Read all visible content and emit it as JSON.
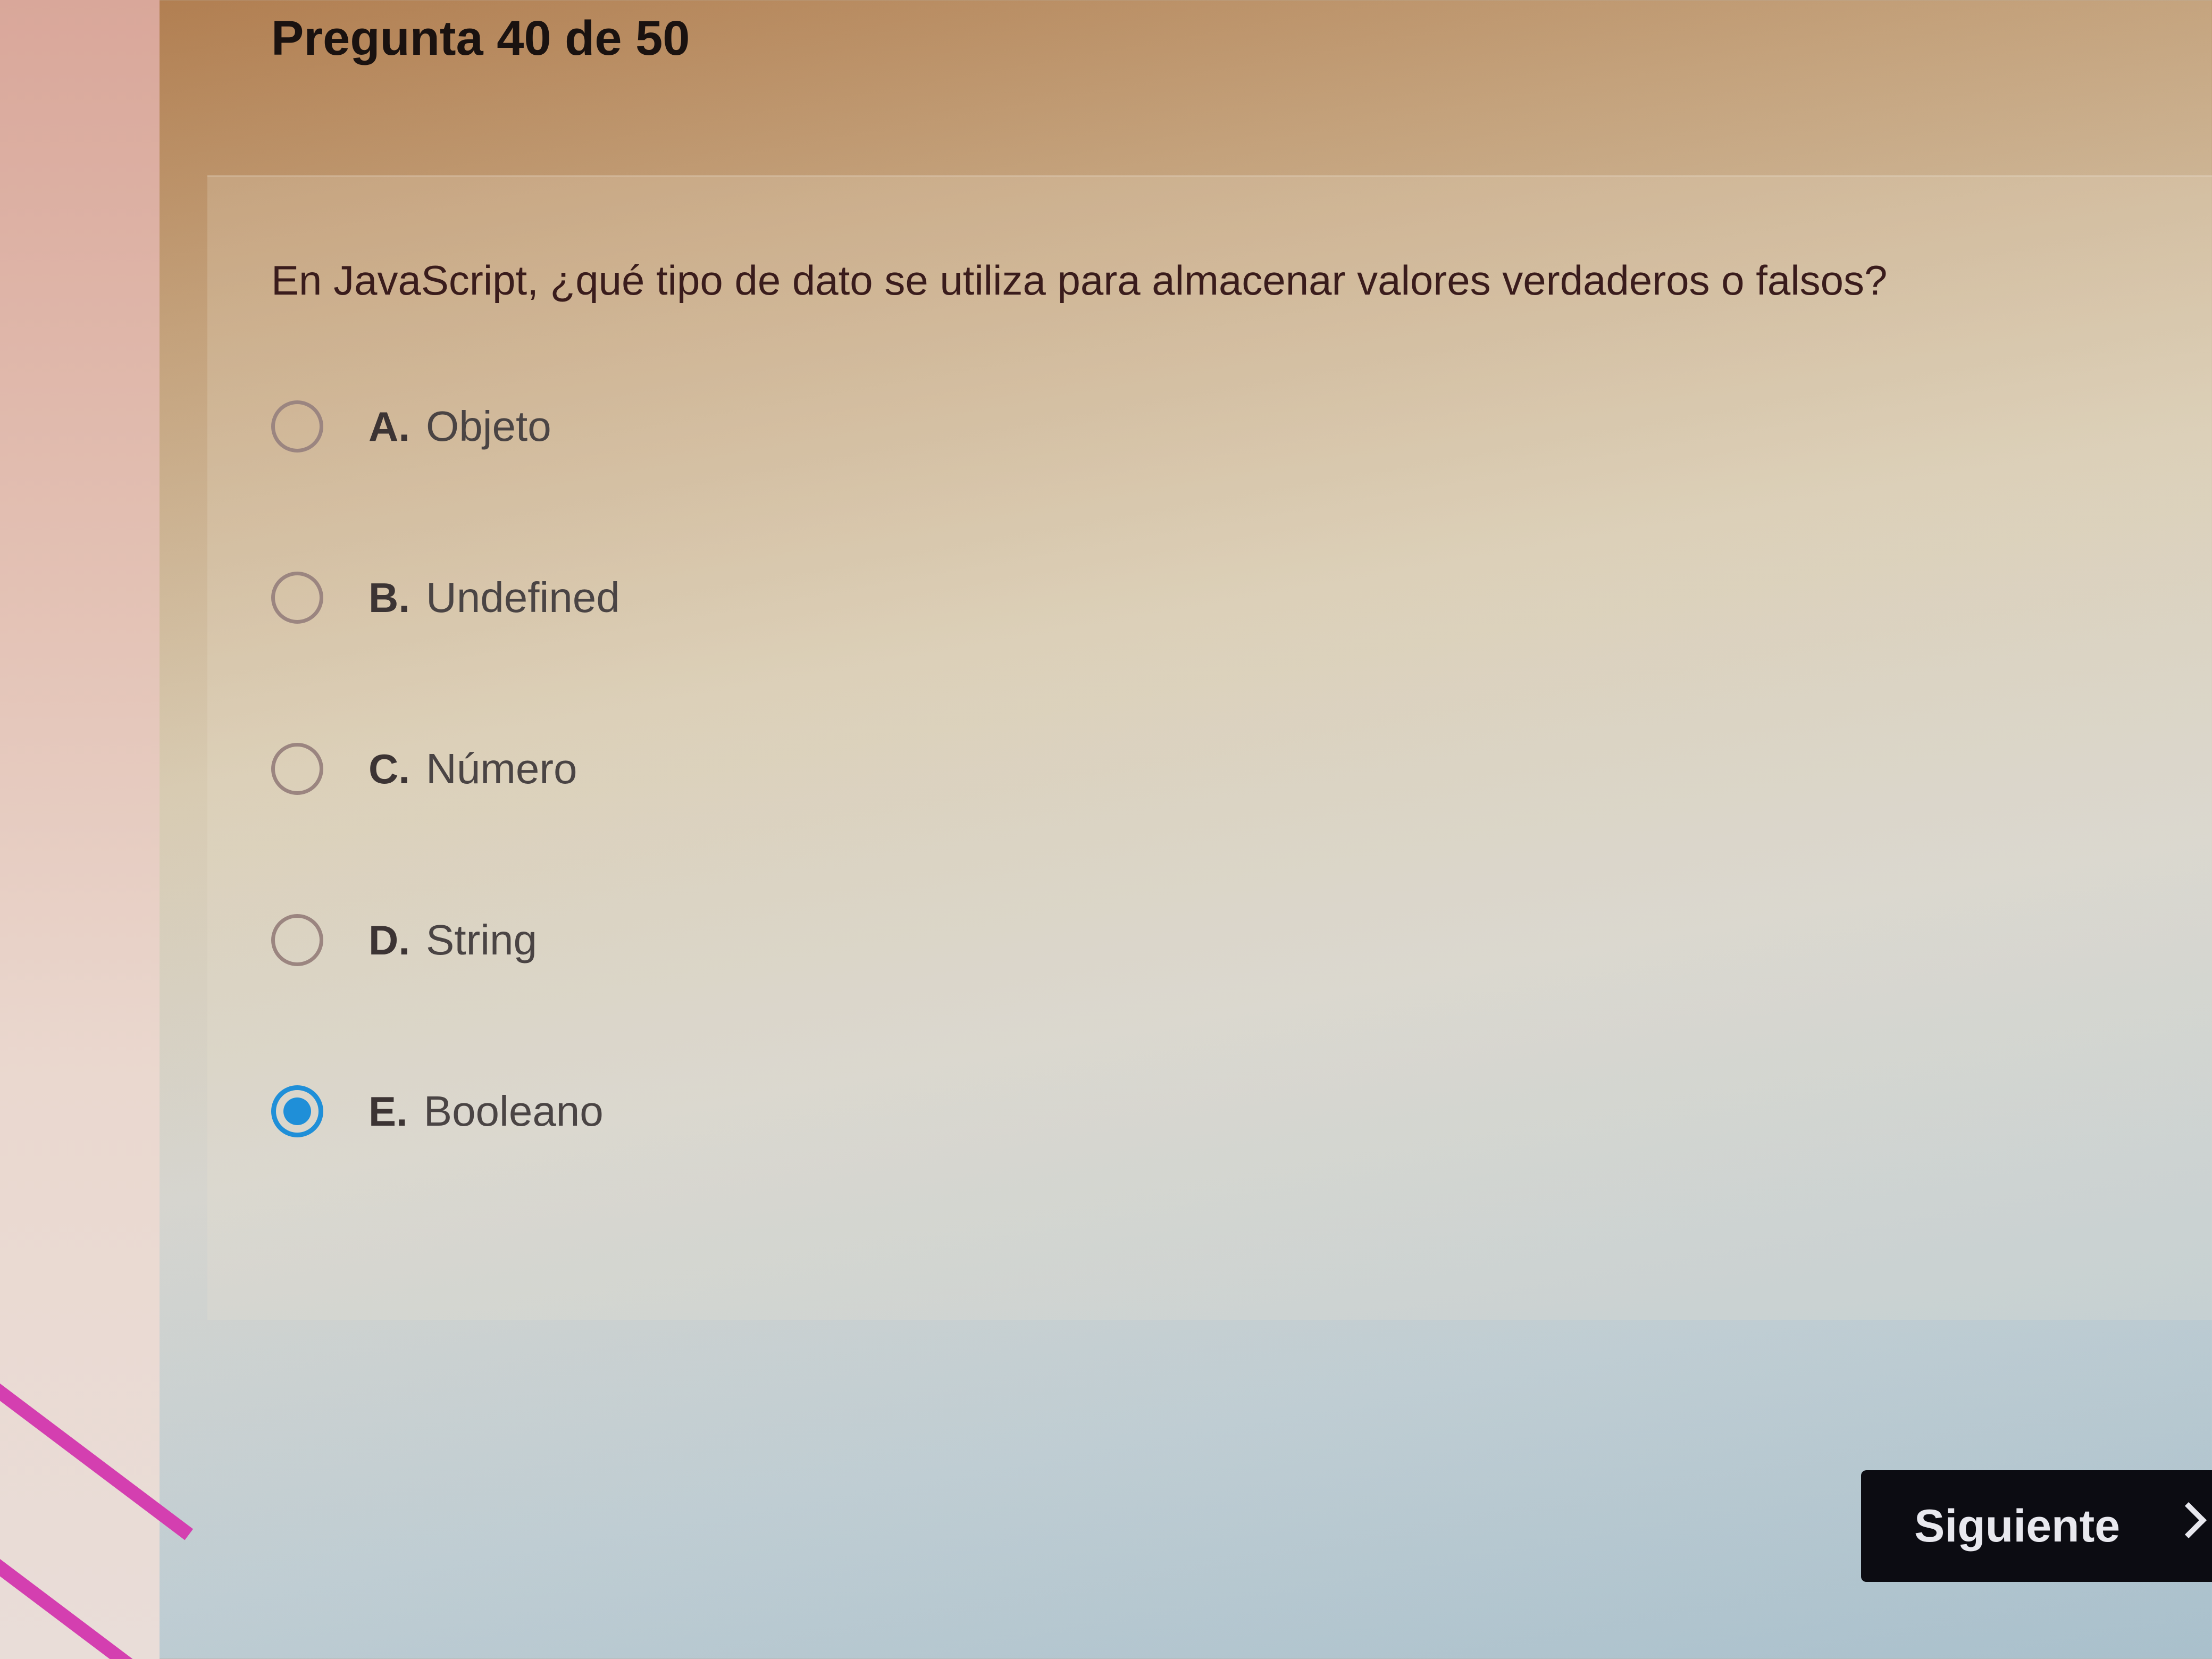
{
  "header": {
    "question_counter": "Pregunta 40 de 50"
  },
  "question": {
    "text": "En JavaScript, ¿qué tipo de dato se utiliza para almacenar valores verdaderos o falsos?",
    "selected_option": "E",
    "options": [
      {
        "letter": "A.",
        "text": "Objeto",
        "selected": false
      },
      {
        "letter": "B.",
        "text": "Undefined",
        "selected": false
      },
      {
        "letter": "C.",
        "text": "Número",
        "selected": false
      },
      {
        "letter": "D.",
        "text": "String",
        "selected": false
      },
      {
        "letter": "E.",
        "text": "Booleano",
        "selected": true
      }
    ]
  },
  "footer": {
    "next_label": "Siguiente",
    "next_icon": "chevron-right-icon"
  },
  "colors": {
    "accent": "#1f8fd8",
    "button_bg": "#0c0c12",
    "decor_stripe": "#d43fb0"
  }
}
